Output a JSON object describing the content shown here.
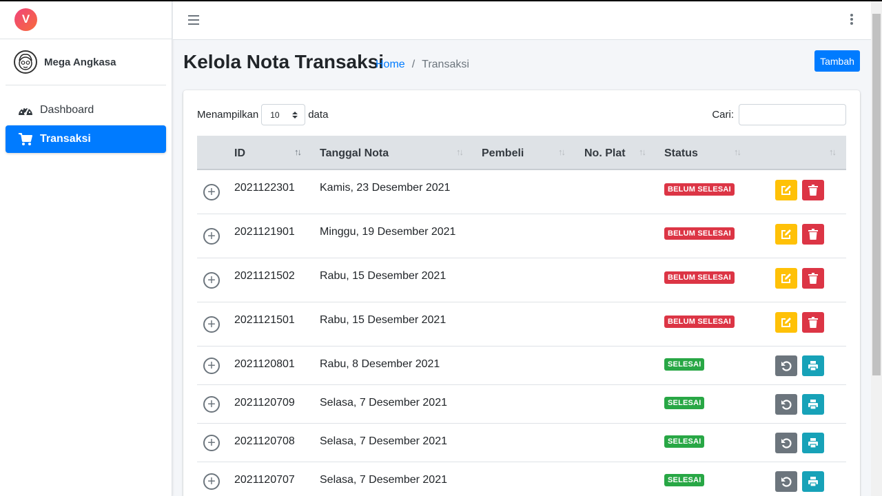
{
  "brand": {
    "logo_letter": "V"
  },
  "user": {
    "name": "Mega Angkasa"
  },
  "sidebar": {
    "items": [
      {
        "label": "Dashboard",
        "icon": "tachometer-icon"
      },
      {
        "label": "Transaksi",
        "icon": "shopping-cart-icon",
        "active": true
      }
    ]
  },
  "header": {
    "menu_icon": "hamburger-icon",
    "more_icon": "kebab-icon"
  },
  "page": {
    "title": "Kelola Nota Transaksi",
    "breadcrumb": {
      "home": "Home",
      "separator": "/",
      "current": "Transaksi"
    },
    "add_button": "Tambah"
  },
  "table_controls": {
    "show_prefix": "Menampilkan",
    "page_size": "10",
    "show_suffix": "data",
    "search_label": "Cari:",
    "search_value": ""
  },
  "table": {
    "columns": [
      "ID",
      "Tanggal Nota",
      "Pembeli",
      "No. Plat",
      "Status"
    ],
    "rows": [
      {
        "id": "2021122301",
        "tanggal": "Kamis, 23 Desember 2021",
        "pembeli": "",
        "plat": "",
        "status": "BELUM SELESAI"
      },
      {
        "id": "2021121901",
        "tanggal": "Minggu, 19 Desember 2021",
        "pembeli": "",
        "plat": "",
        "status": "BELUM SELESAI"
      },
      {
        "id": "2021121502",
        "tanggal": "Rabu, 15 Desember 2021",
        "pembeli": "",
        "plat": "",
        "status": "BELUM SELESAI"
      },
      {
        "id": "2021121501",
        "tanggal": "Rabu, 15 Desember 2021",
        "pembeli": "",
        "plat": "",
        "status": "BELUM SELESAI"
      },
      {
        "id": "2021120801",
        "tanggal": "Rabu, 8 Desember 2021",
        "pembeli": "",
        "plat": "",
        "status": "SELESAI"
      },
      {
        "id": "2021120709",
        "tanggal": "Selasa, 7 Desember 2021",
        "pembeli": "",
        "plat": "",
        "status": "SELESAI"
      },
      {
        "id": "2021120708",
        "tanggal": "Selasa, 7 Desember 2021",
        "pembeli": "",
        "plat": "",
        "status": "SELESAI"
      },
      {
        "id": "2021120707",
        "tanggal": "Selasa, 7 Desember 2021",
        "pembeli": "",
        "plat": "",
        "status": "SELESAI"
      }
    ]
  },
  "colors": {
    "primary": "#007bff",
    "danger": "#dc3545",
    "success": "#28a745",
    "warning": "#ffc107",
    "secondary": "#6c757d",
    "info": "#17a2b8"
  }
}
